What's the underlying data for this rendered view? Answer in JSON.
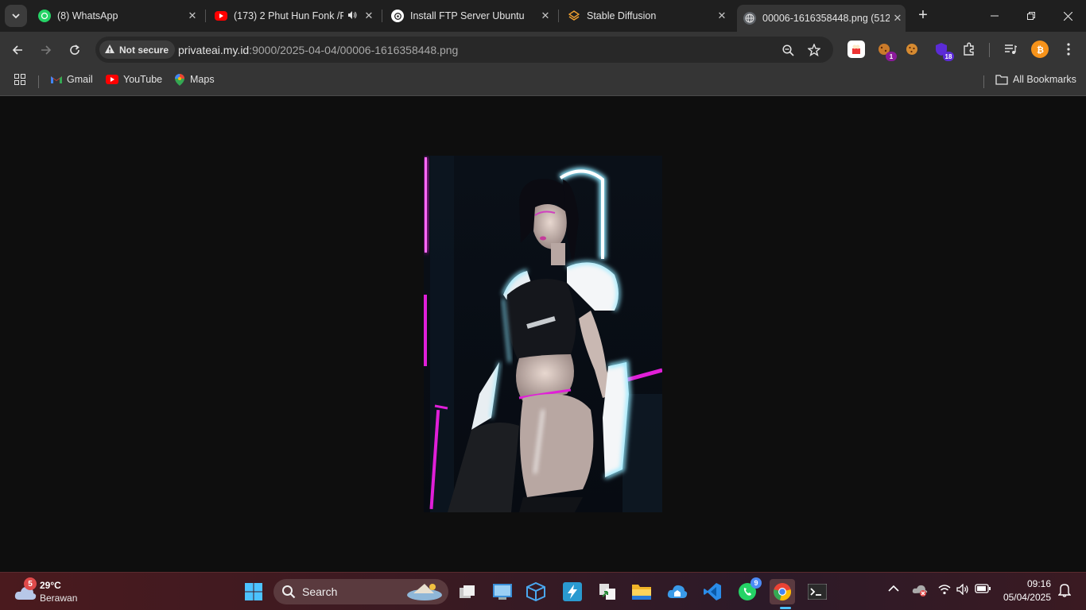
{
  "tabs": [
    {
      "title": "(8) WhatsApp",
      "favicon": "whatsapp-icon"
    },
    {
      "title": "(173) 2 Phut Hun Fonk /F",
      "favicon": "youtube-icon"
    },
    {
      "title": "Install FTP Server Ubuntu",
      "favicon": "openai-icon"
    },
    {
      "title": "Stable Diffusion",
      "favicon": "stable-diffusion-icon"
    },
    {
      "title": "00006-1616358448.png (512",
      "favicon": "globe-icon"
    }
  ],
  "omnibox": {
    "security_label": "Not secure",
    "url_host": "privateai.my.id",
    "url_rest": ":9000/2025-04-04/00006-1616358448.png"
  },
  "extensions": {
    "badge_1": "1",
    "badge_18": "18"
  },
  "bookmarks": {
    "items": [
      "Gmail",
      "YouTube",
      "Maps"
    ],
    "all_bookmarks": "All Bookmarks"
  },
  "taskbar": {
    "weather_temp": "29°C",
    "weather_cond": "Berawan",
    "weather_badge": "5",
    "search_label": "Search",
    "whatsapp_badge": "9",
    "time": "09:16",
    "date": "05/04/2025"
  },
  "colors": {
    "neon_cyan": "#8fe8ff",
    "neon_magenta": "#e01fd8",
    "accent_blue": "#4c8bf5"
  }
}
